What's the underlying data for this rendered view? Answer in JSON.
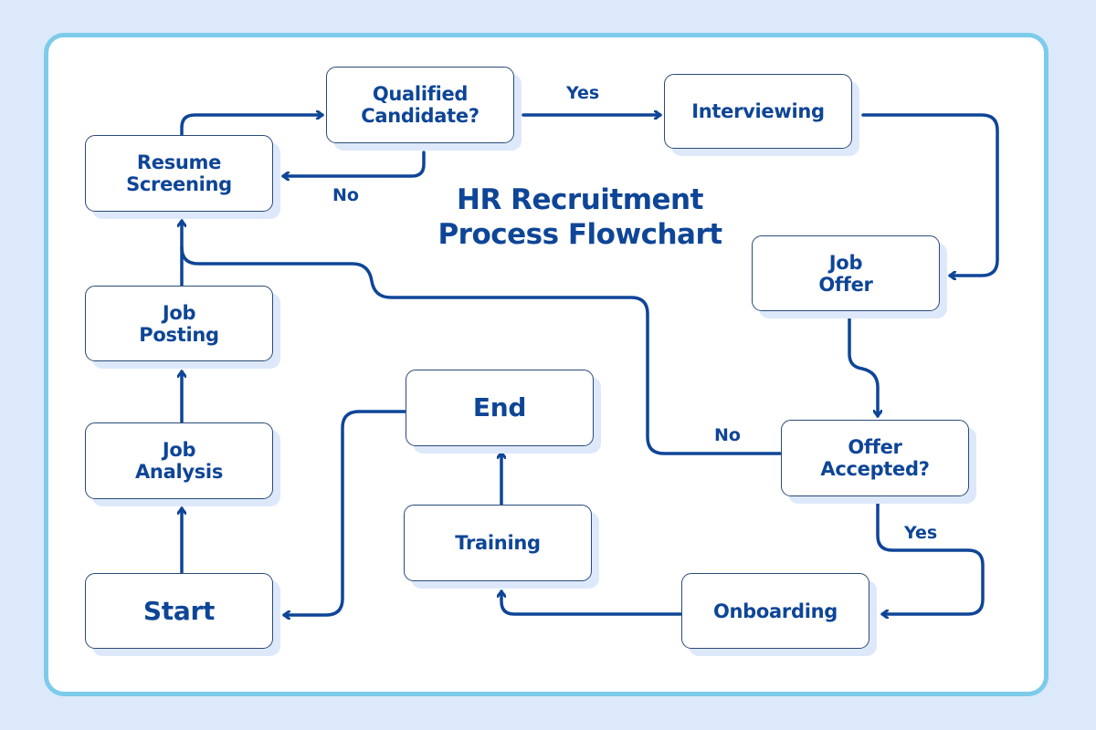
{
  "title": "HR Recruitment\nProcess Flowchart",
  "colors": {
    "background": "#dce9fb",
    "frame_border": "#7dcbea",
    "node_text": "#0e4597",
    "node_border": "#2a4a78",
    "connector": "#0e4597",
    "node_shadow": "#dde9fb"
  },
  "nodes": {
    "start": "Start",
    "job_analysis": "Job\nAnalysis",
    "job_posting": "Job\nPosting",
    "resume_screening": "Resume\nScreening",
    "qualified_candidate": "Qualified\nCandidate?",
    "interviewing": "Interviewing",
    "job_offer": "Job\nOffer",
    "offer_accepted": "Offer\nAccepted?",
    "onboarding": "Onboarding",
    "training": "Training",
    "end": "End"
  },
  "edge_labels": {
    "qualified_yes": "Yes",
    "qualified_no": "No",
    "accepted_no": "No",
    "accepted_yes": "Yes"
  },
  "edges": [
    {
      "from": "Start",
      "to": "Job Analysis"
    },
    {
      "from": "Job Analysis",
      "to": "Job Posting"
    },
    {
      "from": "Job Posting",
      "to": "Resume Screening"
    },
    {
      "from": "Resume Screening",
      "to": "Qualified Candidate?"
    },
    {
      "from": "Qualified Candidate?",
      "to": "Interviewing",
      "label": "Yes"
    },
    {
      "from": "Qualified Candidate?",
      "to": "Resume Screening",
      "label": "No"
    },
    {
      "from": "Interviewing",
      "to": "Job Offer"
    },
    {
      "from": "Job Offer",
      "to": "Offer Accepted?"
    },
    {
      "from": "Offer Accepted?",
      "to": "Resume Screening",
      "label": "No"
    },
    {
      "from": "Offer Accepted?",
      "to": "Onboarding",
      "label": "Yes"
    },
    {
      "from": "Onboarding",
      "to": "Training"
    },
    {
      "from": "Training",
      "to": "End"
    },
    {
      "from": "End",
      "to": "Start"
    }
  ]
}
